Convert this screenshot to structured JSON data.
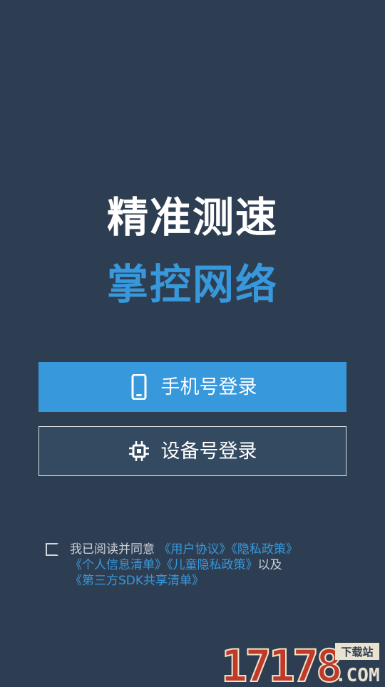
{
  "headline": {
    "line1": "精准测速",
    "line2": "掌控网络"
  },
  "buttons": {
    "phone_login": "手机号登录",
    "device_login": "设备号登录"
  },
  "agreement": {
    "prefix": "我已阅读并同意",
    "user_agreement": "《用户协议》",
    "privacy_policy": "《隐私政策》",
    "personal_info_list": "《个人信息清单》",
    "child_privacy_policy": "《儿童隐私政策》",
    "and": "以及",
    "third_party_sdk_list": "《第三方SDK共享清单》"
  },
  "watermark": {
    "number": "17178",
    "tag": "下载站",
    "domain": ".COM"
  },
  "icons": {
    "phone": "phone-icon",
    "device": "chip-icon"
  },
  "colors": {
    "background": "#2e3e52",
    "accent": "#3898dc",
    "device_button": "#344a61"
  }
}
